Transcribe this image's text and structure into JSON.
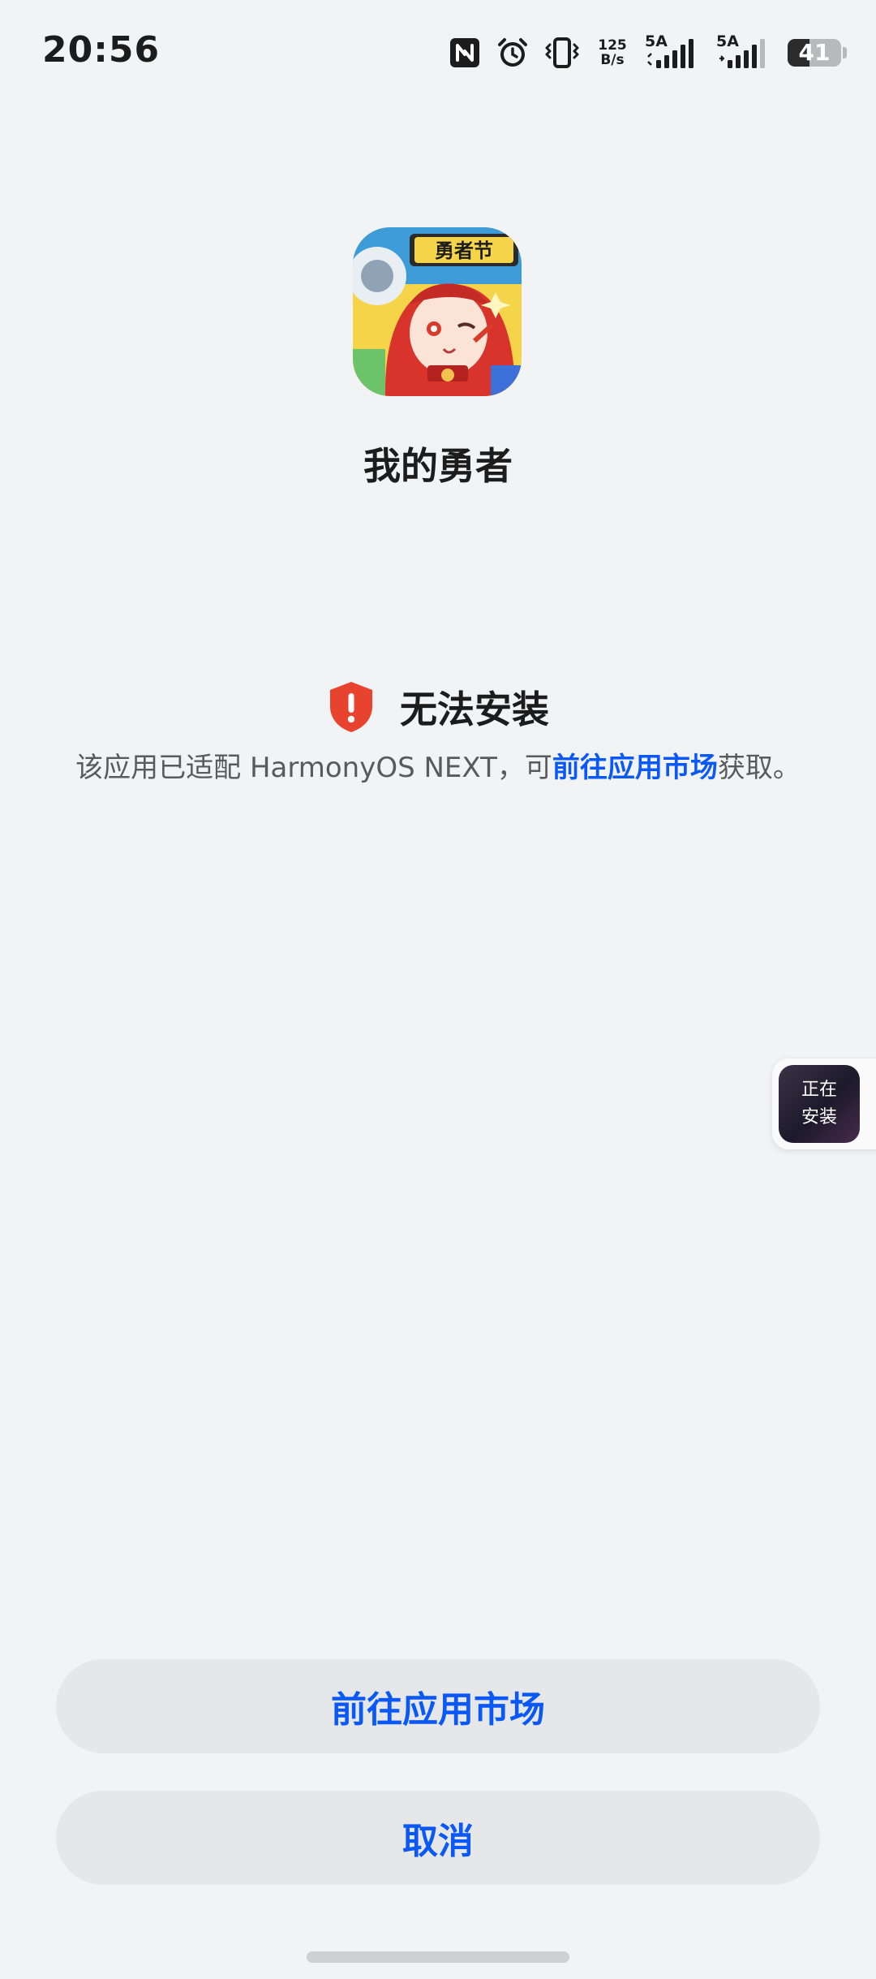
{
  "status_bar": {
    "time": "20:56",
    "net_rate_top": "125",
    "net_rate_bottom": "B/s",
    "sim1_label": "5A",
    "sim2_label": "5A",
    "battery_level": "41"
  },
  "app": {
    "name": "我的勇者",
    "icon_banner": "勇者节"
  },
  "error": {
    "title": "无法安装",
    "desc_prefix": "该应用已适配 HarmonyOS NEXT，可",
    "desc_link": "前往应用市场",
    "desc_suffix": "获取。",
    "icon": "shield-alert-icon",
    "icon_color": "#e8432f"
  },
  "floating_widget": {
    "line1": "正在",
    "line2": "安装"
  },
  "buttons": {
    "market_label": "前往应用市场",
    "cancel_label": "取消"
  },
  "colors": {
    "accent": "#0a59f7",
    "background": "#f1f3f5",
    "button_bg": "#e6e7e9"
  }
}
